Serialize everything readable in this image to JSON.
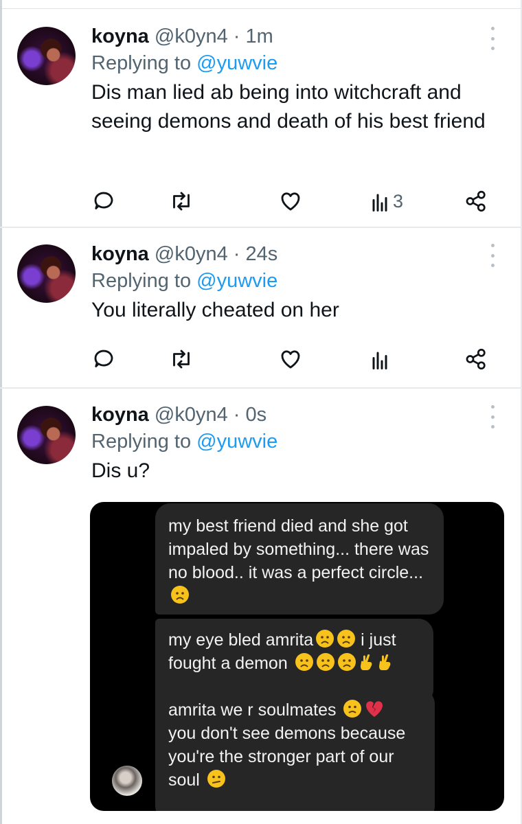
{
  "tweets": [
    {
      "name": "koyna",
      "handle": "@k0yn4",
      "dot": "·",
      "time": "1m",
      "replying_prefix": "Replying to ",
      "replying_to": "@yuwvie",
      "text": "Dis man lied ab being into witchcraft and seeing demons and death of his best friend",
      "views": "3"
    },
    {
      "name": "koyna",
      "handle": "@k0yn4",
      "dot": "·",
      "time": "24s",
      "replying_prefix": "Replying to ",
      "replying_to": "@yuwvie",
      "text": "You literally cheated on her",
      "views": ""
    },
    {
      "name": "koyna",
      "handle": "@k0yn4",
      "dot": "·",
      "time": "0s",
      "replying_prefix": "Replying to ",
      "replying_to": "@yuwvie",
      "text": "Dis u?",
      "views": ""
    }
  ],
  "attached_chat": {
    "messages": [
      {
        "text": "my best friend died and she got impaled by something... there was no blood.. it was a perfect circle...",
        "emojis": [
          "worried-face"
        ]
      },
      {
        "line1": "my eye bled amrita",
        "line1_after": "i just",
        "line2": "fought a demon",
        "emojis": [
          "worried-face",
          "worried-face",
          "worried-face",
          "worried-face",
          "worried-face",
          "crossed-fingers",
          "crossed-fingers"
        ]
      },
      {
        "line1": "amrita we r soulmates",
        "line2": "you don't see demons because you're the stronger part of our soul",
        "emojis": [
          "frowning-face",
          "broken-heart",
          "confused-face"
        ]
      }
    ]
  },
  "colors": {
    "text": "#0f1419",
    "muted": "#536471",
    "link": "#1d9bf0",
    "divider": "#e7e9ea",
    "chat_background": "#000000",
    "chat_bubble": "#262626",
    "emoji_yellow": "#f7c21b"
  },
  "icons": [
    "reply-icon",
    "retweet-icon",
    "like-icon",
    "views-icon",
    "share-icon",
    "more-icon"
  ]
}
